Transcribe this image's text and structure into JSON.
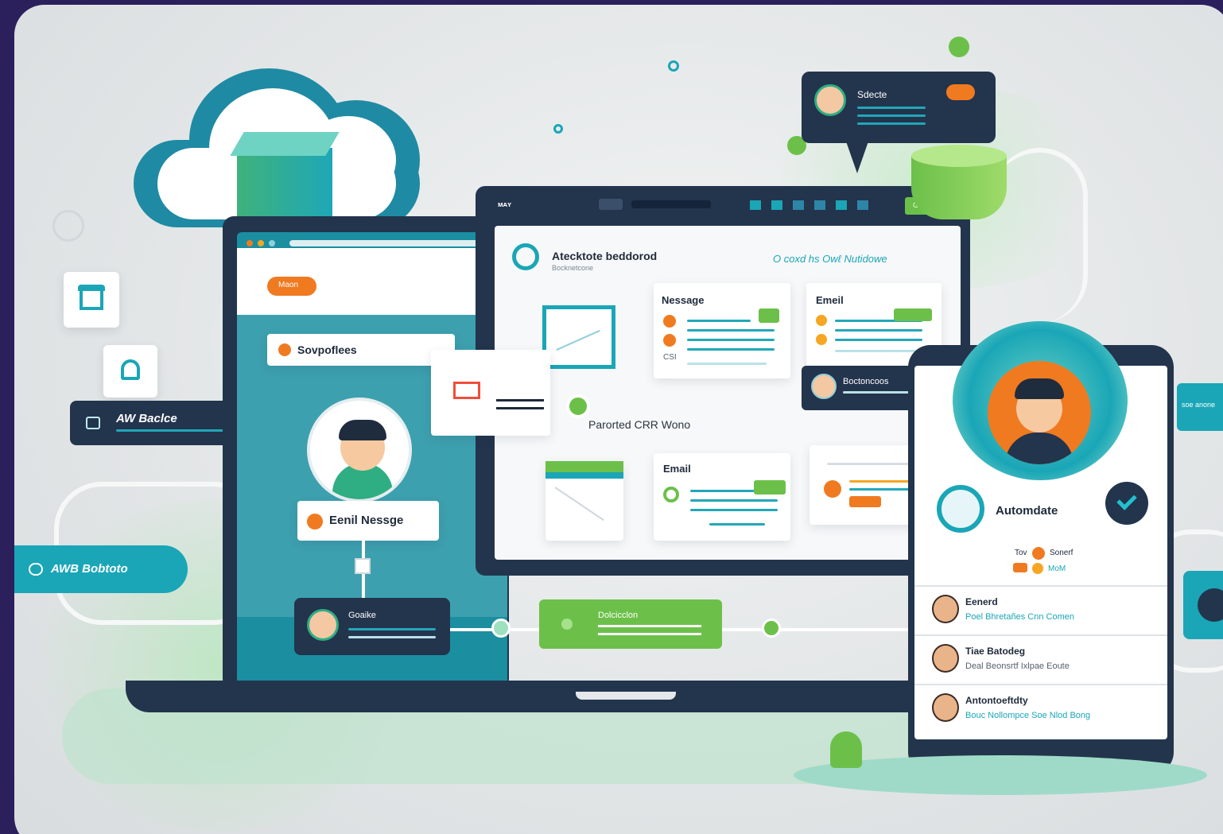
{
  "sidebar_chip": {
    "label": "AW Baclce"
  },
  "pill_left": {
    "label": "AWB Bobtoto"
  },
  "left_screen": {
    "badge": "Maon",
    "services_label": "Sovpoflees"
  },
  "email_message_label": "Eenil Nessge",
  "bottom_card": {
    "label": "Goaike"
  },
  "bottom_green": {
    "label": "Dolcicclon"
  },
  "main_window": {
    "toolbar_left": "ᴍᴀʏ",
    "toolbar_button": "GTEC IG",
    "title": "Atecktote beddorod",
    "subtitle": "Bocknetcone",
    "status": "O coxd hs Oԝℓ Nutidowe",
    "card_message": {
      "title": "Nessage",
      "side": "CSI"
    },
    "card_email_top": {
      "title": "Emeil"
    },
    "card_email_bottom": {
      "title": "Email"
    },
    "workflow_label": "Parorted CRR Wono",
    "contact_card": {
      "label": "Boctoncoos"
    }
  },
  "chat_bubble": {
    "label": "Sdecte"
  },
  "phone": {
    "app_title": "Automdate",
    "filter": {
      "a": "Tov",
      "b": "Sonerf",
      "c": "MoM"
    },
    "contacts": [
      {
        "name": "Eenerd",
        "detail": "Poel Bhretañes Cnn Comen"
      },
      {
        "name": "Tiae Batodeg",
        "detail": "Deal Beonsrtf Ixlpae Eoute"
      },
      {
        "name": "Antontoeftdty",
        "detail": "Bouc Nollompce Soe Nlod Bong"
      }
    ]
  },
  "right_edge": {
    "label": "soe anone"
  },
  "colors": {
    "navy": "#23344d",
    "teal": "#1aa6b7",
    "orange": "#f07a20",
    "green": "#6cc04a",
    "purple_frame": "#2b1f5c"
  }
}
